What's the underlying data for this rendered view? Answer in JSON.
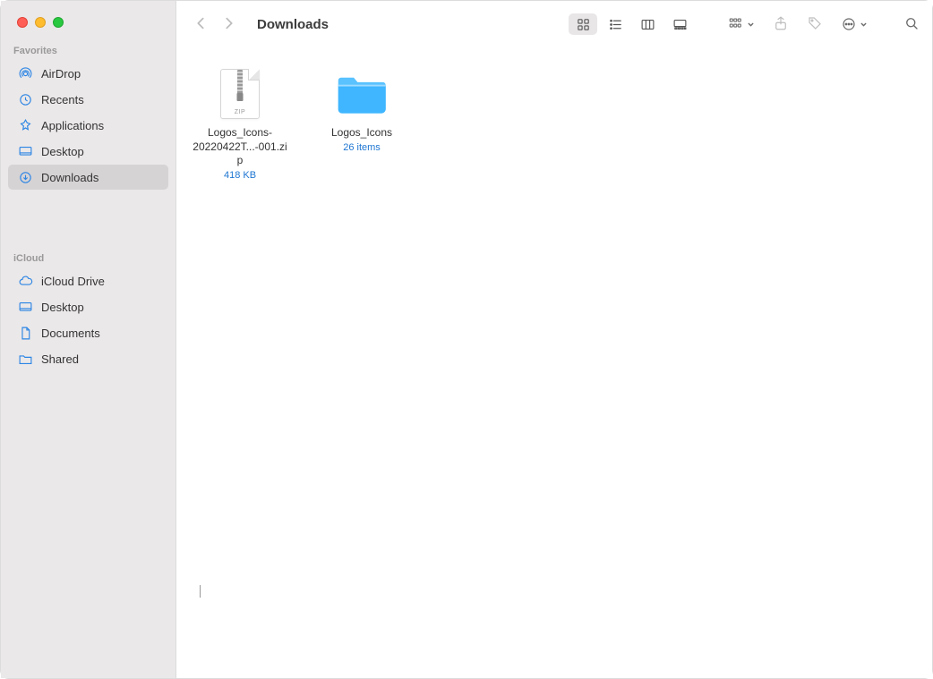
{
  "window": {
    "title": "Downloads"
  },
  "sidebar": {
    "sections": [
      {
        "header": "Favorites",
        "items": [
          {
            "label": "AirDrop",
            "icon": "airdrop"
          },
          {
            "label": "Recents",
            "icon": "clock"
          },
          {
            "label": "Applications",
            "icon": "apps"
          },
          {
            "label": "Desktop",
            "icon": "desktop"
          },
          {
            "label": "Downloads",
            "icon": "download",
            "selected": true
          }
        ]
      },
      {
        "header": "iCloud",
        "items": [
          {
            "label": "iCloud Drive",
            "icon": "cloud"
          },
          {
            "label": "Desktop",
            "icon": "desktop"
          },
          {
            "label": "Documents",
            "icon": "document"
          },
          {
            "label": "Shared",
            "icon": "folder-shared"
          }
        ]
      }
    ]
  },
  "files": [
    {
      "type": "zip",
      "name": "Logos_Icons-20220422T...-001.zip",
      "sub": "418 KB",
      "zip_tag": "ZIP"
    },
    {
      "type": "folder",
      "name": "Logos_Icons",
      "sub": "26 items"
    }
  ],
  "colors": {
    "sidebar_icon": "#2b85e4",
    "folder": "#42b7ff",
    "link_blue": "#1e76d2"
  }
}
